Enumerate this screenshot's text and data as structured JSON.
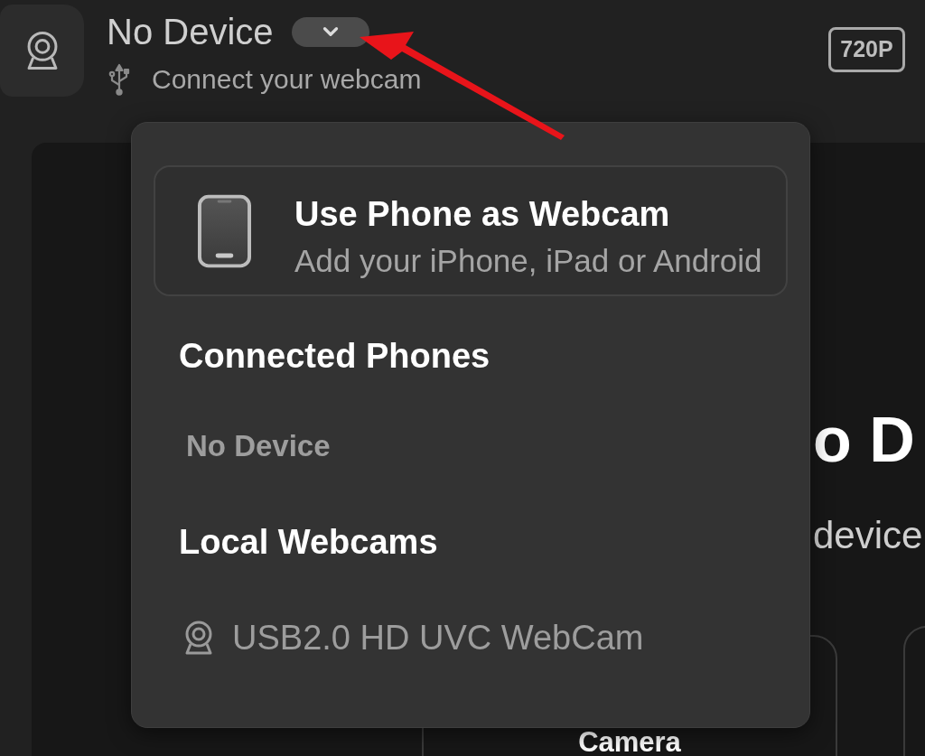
{
  "header": {
    "title": "No Device",
    "status": "Connect your webcam",
    "resolution": "720P"
  },
  "device_menu": {
    "expanded": true,
    "phone_option": {
      "title": "Use Phone as Webcam",
      "subtitle": "Add your iPhone, iPad or Android"
    },
    "sections": [
      {
        "heading": "Connected Phones",
        "items": [
          {
            "kind": "empty",
            "label": "No Device"
          }
        ]
      },
      {
        "heading": "Local Webcams",
        "items": [
          {
            "kind": "webcam",
            "label": "USB2.0 HD UVC WebCam"
          }
        ]
      }
    ]
  },
  "main": {
    "heading": "o D",
    "subheading": "device",
    "card_title": "Camera"
  }
}
